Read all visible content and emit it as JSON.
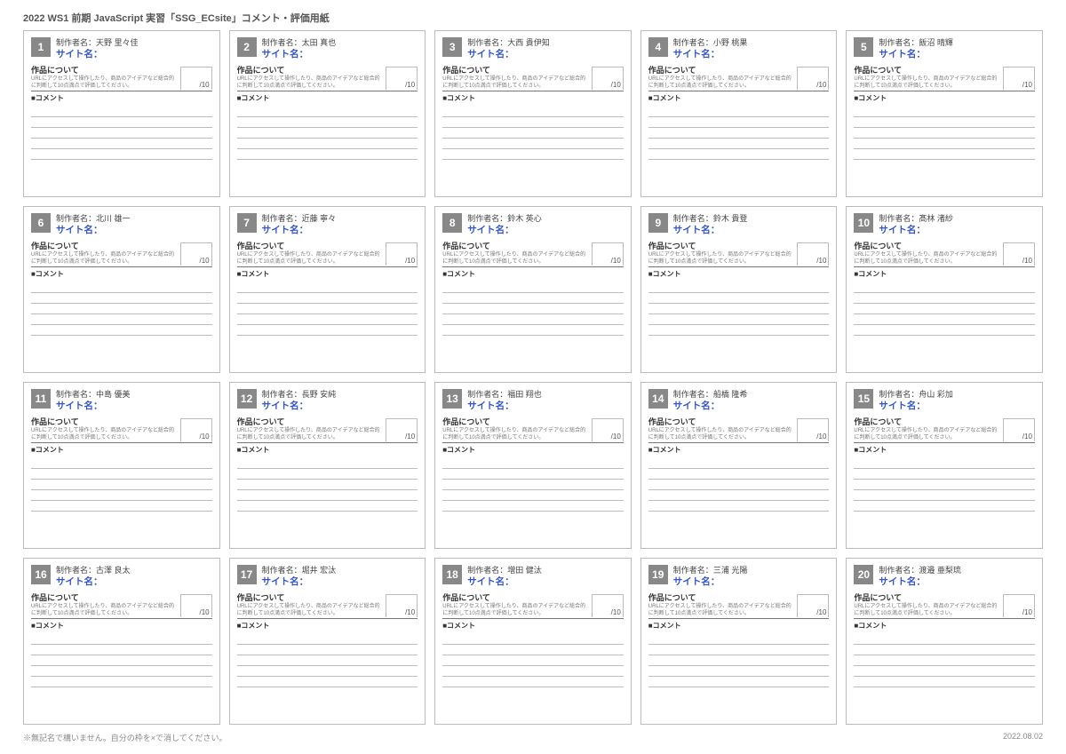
{
  "header": "2022 WS1 前期 JavaScript 実習「SSG_ECsite」コメント・評価用紙",
  "labels": {
    "author_prefix": "制作者名：",
    "sitename": "サイト名：",
    "about": "作品について",
    "instruction": "URLにアクセスして操作したり、商品のアイデアなど総合的に判断して10点満点で評価してください。",
    "score_suffix": "/10",
    "comment": "■コメント"
  },
  "cards": [
    {
      "num": "1",
      "author": "天野 里々佳"
    },
    {
      "num": "2",
      "author": "太田 真也"
    },
    {
      "num": "3",
      "author": "大西 貴伊知"
    },
    {
      "num": "4",
      "author": "小野 桃果"
    },
    {
      "num": "5",
      "author": "飯沼 晴輝"
    },
    {
      "num": "6",
      "author": "北川 雄一"
    },
    {
      "num": "7",
      "author": "近藤 寧々"
    },
    {
      "num": "8",
      "author": "鈴木 英心"
    },
    {
      "num": "9",
      "author": "鈴木 貴登"
    },
    {
      "num": "10",
      "author": "髙林 渚紗"
    },
    {
      "num": "11",
      "author": "中島 優美"
    },
    {
      "num": "12",
      "author": "長野 安純"
    },
    {
      "num": "13",
      "author": "福田 翔也"
    },
    {
      "num": "14",
      "author": "船橋 隆希"
    },
    {
      "num": "15",
      "author": "舟山 彩加"
    },
    {
      "num": "16",
      "author": "古澤 良太"
    },
    {
      "num": "17",
      "author": "堀井 宏汰"
    },
    {
      "num": "18",
      "author": "増田 健汰"
    },
    {
      "num": "19",
      "author": "三浦 光陽"
    },
    {
      "num": "20",
      "author": "渡邉 亜梨琉"
    }
  ],
  "footer": {
    "note": "※無記名で構いません。自分の枠を×で消してください。",
    "date": "2022.08.02"
  }
}
